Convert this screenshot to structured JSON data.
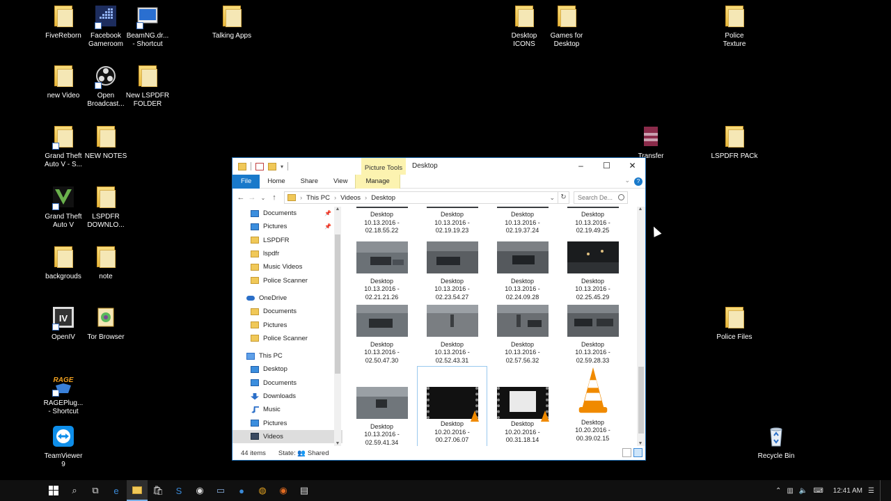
{
  "desktop": {
    "icons": [
      {
        "label": "FiveReborn"
      },
      {
        "label": "Facebook\nGameroom"
      },
      {
        "label": "BeamNG.dr...\n- Shortcut"
      },
      {
        "label": "Talking Apps"
      },
      {
        "label": "Desktop\nICONS"
      },
      {
        "label": "Games for\nDesktop"
      },
      {
        "label": "Police\nTexture"
      },
      {
        "label": "new Video"
      },
      {
        "label": "Open\nBroadcast..."
      },
      {
        "label": "New LSPDFR\nFOLDER"
      },
      {
        "label": "Grand Theft\nAuto V - S..."
      },
      {
        "label": "NEW NOTES"
      },
      {
        "label": "Transfer"
      },
      {
        "label": "LSPDFR PACk"
      },
      {
        "label": "Grand Theft\nAuto V"
      },
      {
        "label": "LSPDFR\nDOWNLO..."
      },
      {
        "label": "backgrouds"
      },
      {
        "label": "note"
      },
      {
        "label": "OpenIV"
      },
      {
        "label": "Tor Browser"
      },
      {
        "label": "Police Files"
      },
      {
        "label": "RAGEPlug...\n- Shortcut"
      },
      {
        "label": "TeamViewer\n9"
      },
      {
        "label": "Recycle Bin"
      }
    ]
  },
  "window": {
    "title": "Desktop",
    "context_tab": "Picture Tools",
    "ribbon_tabs": {
      "file": "File",
      "home": "Home",
      "share": "Share",
      "view": "View",
      "manage": "Manage"
    },
    "controls": {
      "minimize": "–",
      "maximize": "☐",
      "close": "✕"
    },
    "address": {
      "crumb1": "This PC",
      "crumb2": "Videos",
      "crumb3": "Desktop"
    },
    "search_placeholder": "Search De...",
    "nav": [
      {
        "label": "Documents",
        "pinned": true
      },
      {
        "label": "Pictures",
        "pinned": true
      },
      {
        "label": "LSPDFR"
      },
      {
        "label": "lspdfr"
      },
      {
        "label": "Music Videos"
      },
      {
        "label": "Police Scanner"
      },
      {
        "label": "OneDrive"
      },
      {
        "label": "Documents"
      },
      {
        "label": "Pictures"
      },
      {
        "label": "Police Scanner"
      },
      {
        "label": "This PC"
      },
      {
        "label": "Desktop"
      },
      {
        "label": "Documents"
      },
      {
        "label": "Downloads"
      },
      {
        "label": "Music"
      },
      {
        "label": "Pictures"
      },
      {
        "label": "Videos"
      }
    ],
    "files": [
      {
        "caption": "Desktop\n10.13.2016 -\n02.18.55.22"
      },
      {
        "caption": "Desktop\n10.13.2016 -\n02.19.19.23"
      },
      {
        "caption": "Desktop\n10.13.2016 -\n02.19.37.24"
      },
      {
        "caption": "Desktop\n10.13.2016 -\n02.19.49.25"
      },
      {
        "caption": "Desktop\n10.13.2016 -\n02.21.21.26"
      },
      {
        "caption": "Desktop\n10.13.2016 -\n02.23.54.27"
      },
      {
        "caption": "Desktop\n10.13.2016 -\n02.24.09.28"
      },
      {
        "caption": "Desktop\n10.13.2016 -\n02.25.45.29"
      },
      {
        "caption": "Desktop\n10.13.2016 -\n02.50.47.30"
      },
      {
        "caption": "Desktop\n10.13.2016 -\n02.52.43.31"
      },
      {
        "caption": "Desktop\n10.13.2016 -\n02.57.56.32"
      },
      {
        "caption": "Desktop\n10.13.2016 -\n02.59.28.33"
      },
      {
        "caption": "Desktop\n10.13.2016 -\n02.59.41.34"
      },
      {
        "caption": "Desktop\n10.20.2016 -\n00.27.06.07"
      },
      {
        "caption": "Desktop\n10.20.2016 -\n00.31.18.14"
      },
      {
        "caption": "Desktop\n10.20.2016 -\n00.39.02.15"
      }
    ],
    "status": {
      "count": "44 items",
      "state_label": "State:",
      "state_value": "Shared"
    }
  },
  "taskbar": {
    "clock": "12:41 AM"
  },
  "colors": {
    "accent": "#1979ca",
    "folder": "#f0c858",
    "context_tab": "#fcf3b0"
  }
}
